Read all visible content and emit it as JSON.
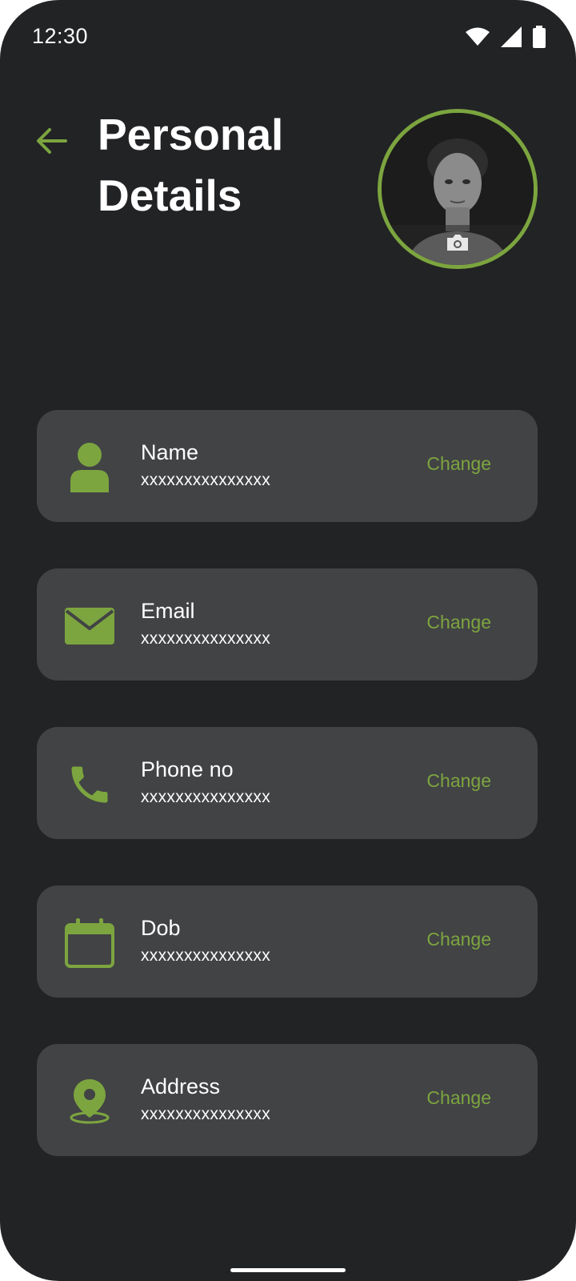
{
  "status_bar": {
    "time": "12:30",
    "icons": [
      "wifi-icon",
      "cellular-signal-icon",
      "battery-icon"
    ]
  },
  "header": {
    "back_icon": "arrow-left-icon",
    "title": "Personal Details",
    "avatar_overlay_icon": "camera-icon"
  },
  "colors": {
    "background": "#222325",
    "card": "#424345",
    "accent": "#7ca53f",
    "text": "#ffffff"
  },
  "fields": [
    {
      "icon": "person-icon",
      "label": "Name",
      "value": "xxxxxxxxxxxxxxx",
      "action": "Change"
    },
    {
      "icon": "mail-icon",
      "label": "Email",
      "value": "xxxxxxxxxxxxxxx",
      "action": "Change"
    },
    {
      "icon": "phone-icon",
      "label": "Phone no",
      "value": "xxxxxxxxxxxxxxx",
      "action": "Change"
    },
    {
      "icon": "calendar-icon",
      "label": "Dob",
      "value": "xxxxxxxxxxxxxxx",
      "action": "Change"
    },
    {
      "icon": "location-pin-icon",
      "label": "Address",
      "value": "xxxxxxxxxxxxxxx",
      "action": "Change"
    }
  ]
}
